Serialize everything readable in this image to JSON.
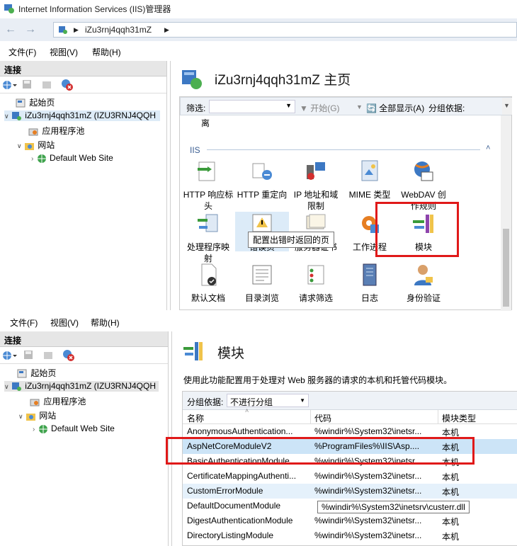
{
  "window": {
    "title": "Internet Information Services (IIS)管理器"
  },
  "address": {
    "node": "iZu3rnj4qqh31mZ"
  },
  "menu": {
    "file": "文件(F)",
    "view": "视图(V)",
    "help": "帮助(H)"
  },
  "connections": {
    "header": "连接",
    "tree": {
      "start": "起始页",
      "server": "iZu3rnj4qqh31mZ (IZU3RNJ4QQH",
      "server2": "iZu3rnj4qqh31mZ (IZU3RNJ4QQH",
      "app_pools": "应用程序池",
      "sites": "网站",
      "default_site": "Default Web Site"
    }
  },
  "home": {
    "title": "iZu3rnj4qqh31mZ 主页",
    "filter_label": "筛选:",
    "start_label": "开始(G)",
    "show_all": "全部显示(A)",
    "group_by": "分组依据:",
    "partial_item": "离",
    "group": "IIS",
    "features": [
      {
        "l1": "HTTP 响应标",
        "l2": "头",
        "icon": "http-headers-icon"
      },
      {
        "l1": "HTTP 重定向",
        "l2": "",
        "icon": "redirect-icon"
      },
      {
        "l1": "IP 地址和域",
        "l2": "限制",
        "icon": "ip-restrictions-icon"
      },
      {
        "l1": "MIME 类型",
        "l2": "",
        "icon": "mime-types-icon"
      },
      {
        "l1": "WebDAV 创",
        "l2": "作规则",
        "icon": "webdav-icon"
      },
      {
        "l1": "处理程序映",
        "l2": "射",
        "icon": "handler-mappings-icon"
      },
      {
        "l1": "错误页",
        "l2": "",
        "icon": "error-pages-icon"
      },
      {
        "l1": "服务器证书",
        "l2": "",
        "icon": "server-certificates-icon"
      },
      {
        "l1": "工作进程",
        "l2": "",
        "icon": "worker-processes-icon"
      },
      {
        "l1": "模块",
        "l2": "",
        "icon": "modules-icon"
      },
      {
        "l1": "默认文档",
        "l2": "",
        "icon": "default-document-icon"
      },
      {
        "l1": "目录浏览",
        "l2": "",
        "icon": "directory-browsing-icon"
      },
      {
        "l1": "请求筛选",
        "l2": "",
        "icon": "request-filtering-icon"
      },
      {
        "l1": "日志",
        "l2": "",
        "icon": "logging-icon"
      },
      {
        "l1": "身份验证",
        "l2": "",
        "icon": "authentication-icon"
      }
    ],
    "tooltip": "配置出错时返回的页"
  },
  "modules": {
    "title": "模块",
    "description": "使用此功能配置用于处理对 Web 服务器的请求的本机和托管代码模块。",
    "group_by": "分组依据:",
    "group_value": "不进行分组",
    "columns": {
      "name": "名称",
      "code": "代码",
      "type": "模块类型"
    },
    "rows": [
      {
        "name": "AnonymousAuthentication...",
        "code": "%windir%\\System32\\inetsr...",
        "type": "本机"
      },
      {
        "name": "AspNetCoreModuleV2",
        "code": "%ProgramFiles%\\IIS\\Asp....",
        "type": "本机"
      },
      {
        "name": "BasicAuthenticationModule",
        "code": "%windir%\\System32\\inetsr...",
        "type": "本机"
      },
      {
        "name": "CertificateMappingAuthenti...",
        "code": "%windir%\\System32\\inetsr...",
        "type": "本机"
      },
      {
        "name": "CustomErrorModule",
        "code": "%windir%\\System32\\inetsr...",
        "type": "本机"
      },
      {
        "name": "DefaultDocumentModule",
        "code": "%windir%\\System32\\inetsrv\\custerr.dll",
        "type": ""
      },
      {
        "name": "DigestAuthenticationModule",
        "code": "%windir%\\System32\\inetsr...",
        "type": "本机"
      },
      {
        "name": "DirectoryListingModule",
        "code": "%windir%\\System32\\inetsr...",
        "type": "本机"
      }
    ]
  }
}
